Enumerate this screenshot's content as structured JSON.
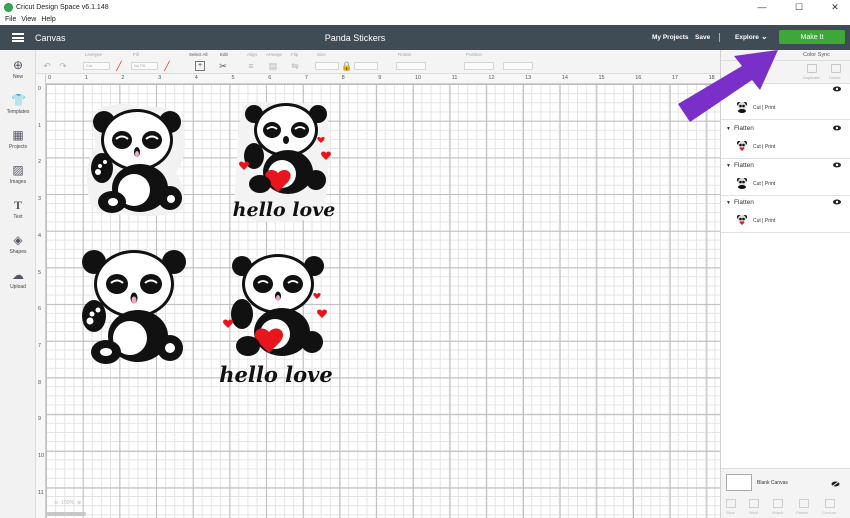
{
  "window": {
    "title": "Cricut Design Space  v6.1.148",
    "controls": [
      "—",
      "☐",
      "✕"
    ]
  },
  "menu": [
    "File",
    "View",
    "Help"
  ],
  "header": {
    "canvas_label": "Canvas",
    "project_title": "Panda Stickers",
    "my_projects": "My Projects",
    "save": "Save",
    "explore": "Explore",
    "make_it": "Make It"
  },
  "toolbar": {
    "groups": [
      "Linetype",
      "Fill",
      "Select All",
      "Edit",
      "Align",
      "Arrange",
      "Flip",
      "Size",
      "Rotate",
      "Position"
    ],
    "linetype_value": "Cut",
    "fill_value": "No Fill"
  },
  "sidebar": {
    "items": [
      "New",
      "Templates",
      "Projects",
      "Images",
      "Text",
      "Shapes",
      "Upload"
    ]
  },
  "rulers": {
    "top": [
      "0",
      "1",
      "2",
      "3",
      "4",
      "5",
      "6",
      "7",
      "8",
      "9",
      "10",
      "11",
      "12",
      "13",
      "14",
      "15",
      "16",
      "17",
      "18"
    ],
    "left": [
      "0",
      "1",
      "2",
      "3",
      "4",
      "5",
      "6",
      "7",
      "8",
      "9",
      "10",
      "11"
    ]
  },
  "canvas": {
    "zoom": "100%",
    "sticker_text": "hello love"
  },
  "panel": {
    "tab_color_sync": "Color Sync",
    "actions": [
      "Slice",
      "Weld",
      "Attach",
      "Flatten",
      "Contour"
    ],
    "top_actions": [
      "Group",
      "UnGroup",
      "Duplicate",
      "Delete"
    ],
    "layers": [
      {
        "name": "Flatten",
        "operation": "Cut | Print"
      },
      {
        "name": "Flatten",
        "operation": "Cut | Print"
      },
      {
        "name": "Flatten",
        "operation": "Cut | Print"
      },
      {
        "name": "Flatten",
        "operation": "Cut | Print"
      }
    ],
    "blank_canvas": "Blank Canvas"
  },
  "colors": {
    "header_bg": "#3f4b55",
    "make_it": "#3fa63a",
    "annotation_arrow": "#7b2fc9",
    "heart": "#e8161c"
  }
}
